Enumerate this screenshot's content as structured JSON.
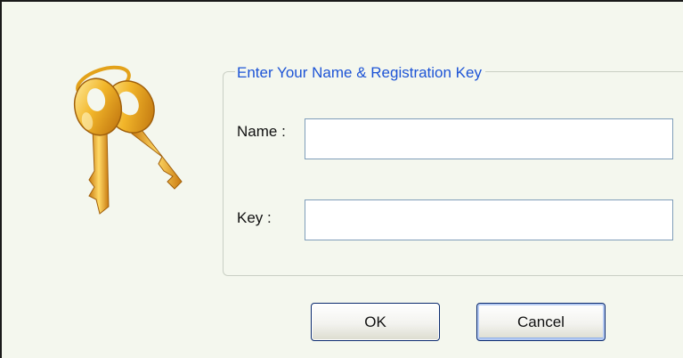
{
  "dialog": {
    "icon": "keys-icon",
    "accent_color": "#1d54d6",
    "background_color": "#f4f7ee"
  },
  "registration": {
    "group_title": "Enter Your Name & Registration Key",
    "name_label": "Name :",
    "name_value": "",
    "key_label": "Key :",
    "key_value": ""
  },
  "buttons": {
    "ok_label": "OK",
    "cancel_label": "Cancel"
  }
}
